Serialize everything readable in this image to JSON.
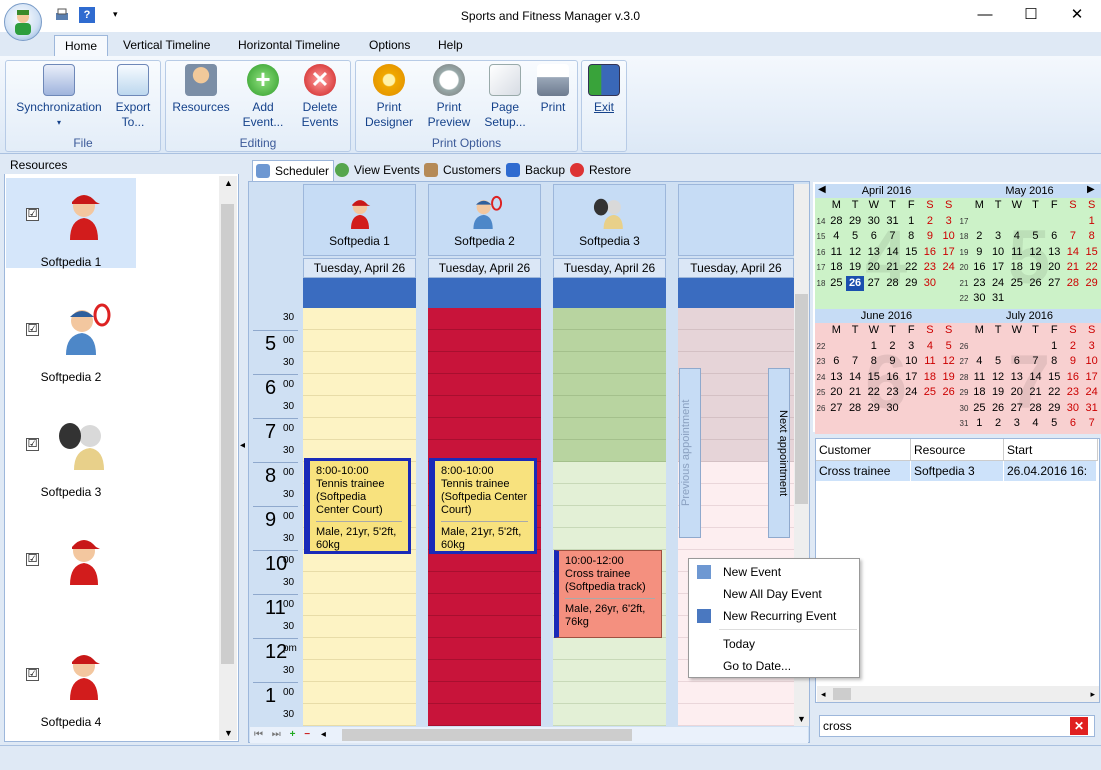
{
  "window": {
    "title": "Sports and Fitness Manager v.3.0"
  },
  "ribbon_tabs": [
    "Home",
    "Vertical Timeline",
    "Horizontal Timeline",
    "Options",
    "Help"
  ],
  "groups": {
    "file": {
      "label": "File",
      "buttons": [
        {
          "l1": "Synchronization",
          "l2": "",
          "icon": "sync-icon"
        },
        {
          "l1": "Export",
          "l2": "To...",
          "icon": "export-icon"
        }
      ]
    },
    "editing": {
      "label": "Editing",
      "buttons": [
        {
          "l1": "Resources",
          "l2": "",
          "icon": "resources-icon"
        },
        {
          "l1": "Add",
          "l2": "Event...",
          "icon": "add-icon"
        },
        {
          "l1": "Delete",
          "l2": "Events",
          "icon": "delete-icon"
        }
      ]
    },
    "print": {
      "label": "Print Options",
      "buttons": [
        {
          "l1": "Print",
          "l2": "Designer",
          "icon": "gear-icon"
        },
        {
          "l1": "Print",
          "l2": "Preview",
          "icon": "magnifier-icon"
        },
        {
          "l1": "Page",
          "l2": "Setup...",
          "icon": "pages-icon"
        },
        {
          "l1": "Print",
          "l2": "",
          "icon": "printer-icon"
        }
      ]
    },
    "exit": {
      "label": "",
      "buttons": [
        {
          "l1": "Exit",
          "l2": "",
          "icon": "exit-icon"
        }
      ]
    }
  },
  "resources_panel": {
    "title": "Resources",
    "items": [
      {
        "name": "Softpedia 1",
        "check": "☑",
        "selected": true
      },
      {
        "name": "Softpedia 2",
        "check": "☑"
      },
      {
        "name": "Softpedia 3",
        "check": "☑"
      },
      {
        "name": "",
        "check": "☑"
      },
      {
        "name": "Softpedia 4",
        "check": "☑"
      }
    ]
  },
  "view_tabs": [
    "Scheduler",
    "View Events",
    "Customers",
    "Backup",
    "Restore"
  ],
  "scheduler": {
    "columns": [
      {
        "name": "Softpedia 1",
        "day": "Tuesday, April 26",
        "color": "#fdf3c4"
      },
      {
        "name": "Softpedia 2",
        "day": "Tuesday, April 26",
        "color": "#c8143a"
      },
      {
        "name": "Softpedia 3",
        "day": "Tuesday, April 26",
        "color": "#d6e8c4"
      },
      {
        "name": "",
        "day": "Tuesday, April 26",
        "color": "#f6e4e8"
      }
    ],
    "hours": [
      {
        "h": "",
        "m": "",
        "h30": "30"
      },
      {
        "h": "5",
        "m": "00",
        "h30": "30"
      },
      {
        "h": "6",
        "m": "00",
        "h30": "30"
      },
      {
        "h": "7",
        "m": "00",
        "h30": "30"
      },
      {
        "h": "8",
        "m": "00",
        "h30": "30"
      },
      {
        "h": "9",
        "m": "00",
        "h30": "30"
      },
      {
        "h": "10",
        "m": "00",
        "h30": "30"
      },
      {
        "h": "11",
        "m": "00",
        "h30": "30"
      },
      {
        "h": "12",
        "m": "pm",
        "h30": "30"
      },
      {
        "h": "1",
        "m": "00",
        "h30": "30"
      }
    ],
    "events": [
      {
        "title": "8:00-10:00 Tennis trainee (Softpedia Center Court)",
        "desc": "Male, 21yr, 5'2ft, 60kg"
      },
      {
        "title": "8:00-10:00 Tennis trainee (Softpedia Center Court)",
        "desc": "Male, 21yr, 5'2ft, 60kg"
      },
      {
        "title": "10:00-12:00 Cross trainee (Softpedia track)",
        "desc": "Male, 26yr, 6'2ft, 76kg"
      }
    ],
    "prev_label": "Previous appointment",
    "next_label": "Next appointment"
  },
  "context_menu": [
    "New Event",
    "New All Day Event",
    "New Recurring Event",
    "Today",
    "Go to Date..."
  ],
  "calendar": {
    "dow": [
      "M",
      "T",
      "W",
      "T",
      "F",
      "S",
      "S"
    ],
    "months": [
      {
        "name": "April 2016",
        "big": "4",
        "rows": [
          [
            "14",
            "28",
            "29",
            "30",
            "31",
            "1",
            "2",
            "3"
          ],
          [
            "15",
            "4",
            "5",
            "6",
            "7",
            "8",
            "9",
            "10"
          ],
          [
            "16",
            "11",
            "12",
            "13",
            "14",
            "15",
            "16",
            "17"
          ],
          [
            "17",
            "18",
            "19",
            "20",
            "21",
            "22",
            "23",
            "24"
          ],
          [
            "18",
            "25",
            "26",
            "27",
            "28",
            "29",
            "30",
            ""
          ]
        ],
        "today": "26",
        "bg": "#ccf2c8"
      },
      {
        "name": "May 2016",
        "big": "5",
        "rows": [
          [
            "17",
            "",
            "",
            "",
            "",
            "",
            "",
            "1"
          ],
          [
            "18",
            "2",
            "3",
            "4",
            "5",
            "6",
            "7",
            "8"
          ],
          [
            "19",
            "9",
            "10",
            "11",
            "12",
            "13",
            "14",
            "15"
          ],
          [
            "20",
            "16",
            "17",
            "18",
            "19",
            "20",
            "21",
            "22"
          ],
          [
            "21",
            "23",
            "24",
            "25",
            "26",
            "27",
            "28",
            "29"
          ],
          [
            "22",
            "30",
            "31",
            "",
            "",
            "",
            "",
            ""
          ]
        ],
        "bg": "#ccf2c8"
      },
      {
        "name": "June 2016",
        "big": "6",
        "rows": [
          [
            "22",
            "",
            "",
            "1",
            "2",
            "3",
            "4",
            "5"
          ],
          [
            "23",
            "6",
            "7",
            "8",
            "9",
            "10",
            "11",
            "12"
          ],
          [
            "24",
            "13",
            "14",
            "15",
            "16",
            "17",
            "18",
            "19"
          ],
          [
            "25",
            "20",
            "21",
            "22",
            "23",
            "24",
            "25",
            "26"
          ],
          [
            "26",
            "27",
            "28",
            "29",
            "30",
            "",
            "",
            ""
          ]
        ],
        "bg": "#f8d0d0"
      },
      {
        "name": "July 2016",
        "big": "7",
        "rows": [
          [
            "26",
            "",
            "",
            "",
            "",
            "1",
            "2",
            "3"
          ],
          [
            "27",
            "4",
            "5",
            "6",
            "7",
            "8",
            "9",
            "10"
          ],
          [
            "28",
            "11",
            "12",
            "13",
            "14",
            "15",
            "16",
            "17"
          ],
          [
            "29",
            "18",
            "19",
            "20",
            "21",
            "22",
            "23",
            "24"
          ],
          [
            "30",
            "25",
            "26",
            "27",
            "28",
            "29",
            "30",
            "31"
          ],
          [
            "31",
            "1",
            "2",
            "3",
            "4",
            "5",
            "6",
            "7"
          ]
        ],
        "bg": "#f8d0d0"
      }
    ]
  },
  "grid": {
    "headers": [
      "Customer",
      "Resource",
      "Start"
    ],
    "rows": [
      [
        "Cross trainee",
        "Softpedia 3",
        "26.04.2016 16:"
      ]
    ]
  },
  "search": {
    "value": "cross"
  }
}
